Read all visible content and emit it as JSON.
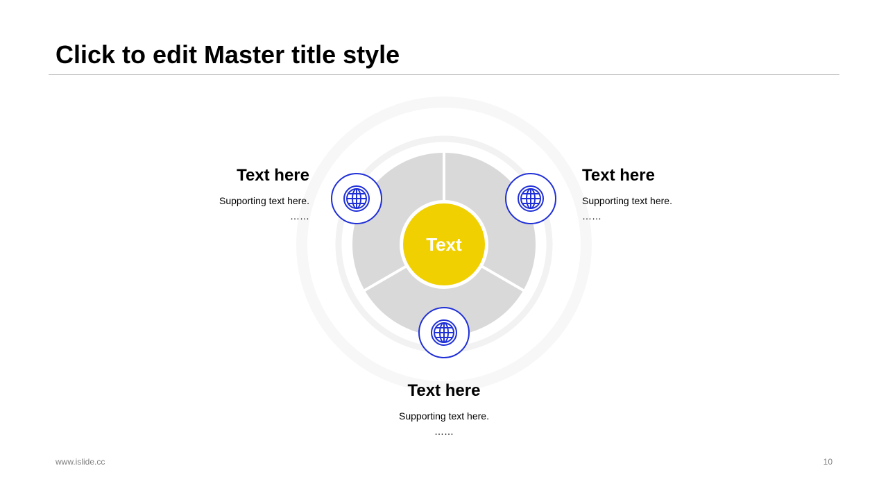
{
  "slide": {
    "title": "Click to edit Master title style",
    "footer": "www.islide.cc",
    "page_number": "10"
  },
  "diagram": {
    "center_label": "Text",
    "colors": {
      "accent": "#F0D000",
      "icon": "#1F2FD6",
      "segment": "#D9D9D9",
      "ring": "#F2F2F2"
    },
    "items": [
      {
        "heading": "Text here",
        "body": "Supporting text here.",
        "ellipsis": "……",
        "icon": "globe-icon"
      },
      {
        "heading": "Text here",
        "body": "Supporting text here.",
        "ellipsis": "……",
        "icon": "globe-icon"
      },
      {
        "heading": "Text here",
        "body": "Supporting text here.",
        "ellipsis": "……",
        "icon": "globe-icon"
      }
    ]
  }
}
